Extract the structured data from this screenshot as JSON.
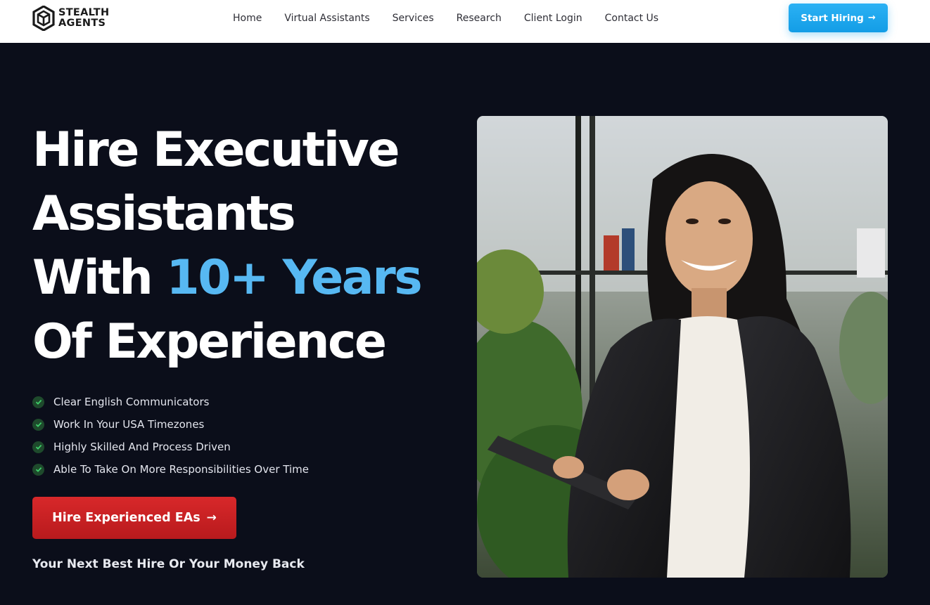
{
  "header": {
    "logo": {
      "line1": "STEALTH",
      "line2": "AGENTS",
      "icon": "hexagon-logo-icon"
    },
    "nav": [
      {
        "label": "Home"
      },
      {
        "label": "Virtual Assistants"
      },
      {
        "label": "Services"
      },
      {
        "label": "Research"
      },
      {
        "label": "Client Login"
      },
      {
        "label": "Contact Us"
      }
    ],
    "cta": {
      "label": "Start Hiring",
      "icon": "arrow-right-icon",
      "color": "#1ea7ee"
    }
  },
  "hero": {
    "headline": {
      "line1": "Hire Executive",
      "line2": "Assistants",
      "line3_prefix": "With ",
      "line3_accent": "10+ Years",
      "line4": "Of Experience",
      "accent_color": "#57b8f2"
    },
    "features": [
      {
        "text": "Clear English Communicators",
        "icon": "check-circle-icon"
      },
      {
        "text": "Work In Your USA Timezones",
        "icon": "check-circle-icon"
      },
      {
        "text": "Highly Skilled And Process Driven",
        "icon": "check-circle-icon"
      },
      {
        "text": "Able To Take On More Responsibilities Over Time",
        "icon": "check-circle-icon"
      }
    ],
    "cta": {
      "label": "Hire Experienced EAs",
      "icon": "arrow-right-icon",
      "color": "#c92022"
    },
    "guarantee": "Your Next Best Hire Or Your Money Back",
    "photo": {
      "subject": "woman-holding-tablet-photo"
    }
  },
  "colors": {
    "background": "#0b0e1a",
    "header_bg": "#ffffff",
    "check_bg": "#1e4a2c",
    "check_mark": "#3fcf6a"
  }
}
